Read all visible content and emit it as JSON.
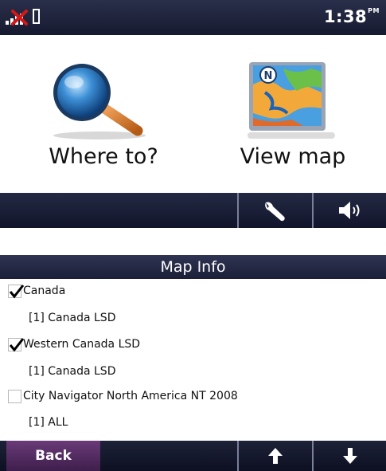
{
  "status_bar": {
    "time": "1:38",
    "time_suffix": "PM",
    "icons": [
      "satellite-signal-icon",
      "battery-icon"
    ]
  },
  "main_menu": {
    "where_to_label": "Where to?",
    "view_map_label": "View map",
    "where_to_icon": "magnifying-glass-icon",
    "view_map_icon": "map-icon",
    "map_icon_north": "N"
  },
  "main_toolbar": {
    "icons": [
      "wrench-icon",
      "volume-icon"
    ]
  },
  "map_info": {
    "title": "Map Info",
    "maps": [
      {
        "name": "Canada",
        "checked": true,
        "sub": "[1] Canada LSD"
      },
      {
        "name": "Western Canada LSD",
        "checked": true,
        "sub": "[1] Canada LSD"
      },
      {
        "name": "City Navigator North America NT 2008",
        "checked": false,
        "sub": "[1] ALL"
      }
    ],
    "back_label": "Back",
    "icons": [
      "arrow-up-icon",
      "arrow-down-icon"
    ]
  },
  "colors": {
    "bar_dark": "#161a30",
    "back_button": "#5a3068",
    "text": "#111111"
  }
}
